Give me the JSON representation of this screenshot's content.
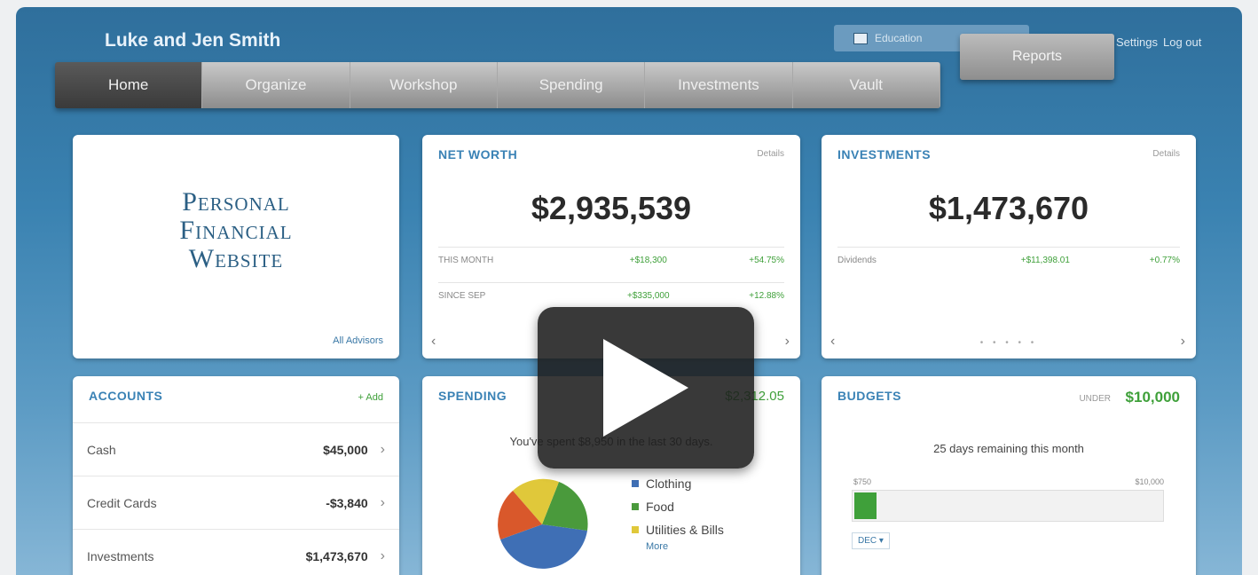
{
  "header": {
    "owner_name": "Luke and Jen Smith",
    "education_label": "Education",
    "reports_label": "Reports",
    "top_links": [
      "Settings",
      "Log out"
    ]
  },
  "nav": {
    "tabs": [
      {
        "label": "Home",
        "active": true
      },
      {
        "label": "Organize"
      },
      {
        "label": "Workshop"
      },
      {
        "label": "Spending"
      },
      {
        "label": "Investments"
      },
      {
        "label": "Vault"
      }
    ]
  },
  "logo_card": {
    "lines": [
      "Personal",
      "Financial",
      "Website"
    ],
    "link": "All Advisors"
  },
  "net_worth": {
    "title": "NET WORTH",
    "right_label": "Details",
    "value": "$2,935,539",
    "rows": [
      {
        "label": "THIS MONTH",
        "change": "+$18,300",
        "percent": "+54.75%"
      },
      {
        "label": "SINCE SEP",
        "change": "+$335,000",
        "percent": "+12.88%"
      }
    ]
  },
  "investments": {
    "title": "INVESTMENTS",
    "right_label": "Details",
    "value": "$1,473,670",
    "rows": [
      {
        "label": "Dividends",
        "change": "+$11,398.01",
        "percent": "+0.77%"
      }
    ],
    "dots": "• • • • •"
  },
  "accounts": {
    "title": "ACCOUNTS",
    "add_label": "+ Add",
    "items": [
      {
        "name": "Cash",
        "value": "$45,000"
      },
      {
        "name": "Credit Cards",
        "value": "-$3,840"
      },
      {
        "name": "Investments",
        "value": "$1,473,670"
      }
    ]
  },
  "spending": {
    "title": "SPENDING",
    "amount": "$2,312.05",
    "subtitle": "You've spent $8,950 in the last 30 days.",
    "legend": [
      {
        "label": "Clothing",
        "color": "#3f6fb5"
      },
      {
        "label": "Food",
        "color": "#4a9a3c"
      },
      {
        "label": "Utilities & Bills",
        "color": "#e0c83a"
      }
    ],
    "more_label": "More",
    "slice_colors": [
      "#3f6fb5",
      "#4a9a3c",
      "#e0c83a",
      "#d9582b"
    ]
  },
  "budgets": {
    "title": "BUDGETS",
    "under_label": "UNDER",
    "amount": "$10,000",
    "subtitle": "25 days remaining this month",
    "bar_left": "$750",
    "bar_right": "$10,000",
    "fill_percent": 7,
    "link": "DEC ▾"
  },
  "play_button": {
    "icon": "play-icon"
  }
}
